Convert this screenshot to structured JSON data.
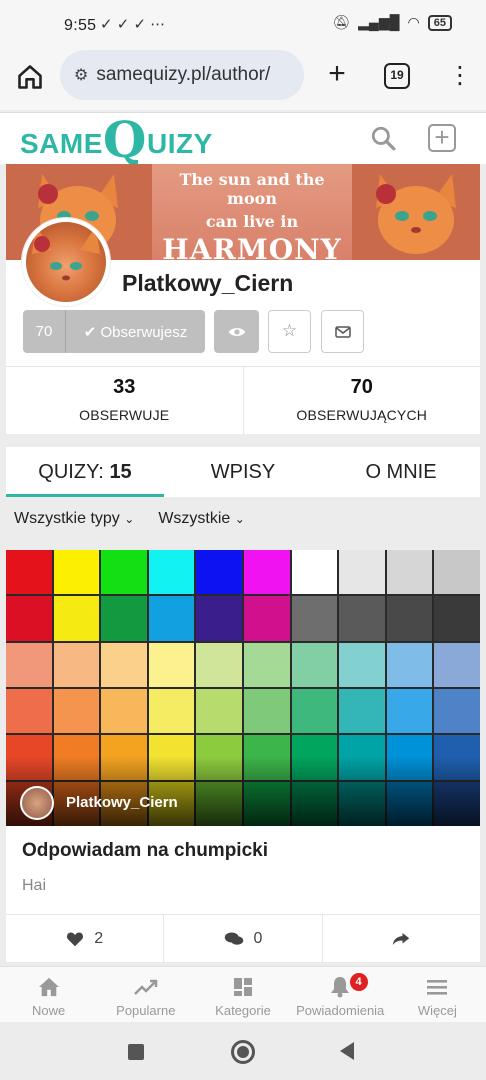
{
  "status_bar": {
    "time": "9:55",
    "status_icons": "✓ ✓ ✓ ⋯",
    "battery": "65"
  },
  "browser": {
    "url": "samequizy.pl/author/",
    "tab_count": "19"
  },
  "site": {
    "logo_prefix": "same",
    "logo_q": "Q",
    "logo_suffix": "uizy",
    "accent_color": "#2fb7a6"
  },
  "banner": {
    "line1": "The sun and the moon",
    "line2": "can live in",
    "line3": "HARMONY"
  },
  "profile": {
    "username": "Platkowy_Ciern",
    "follower_count_button": "70",
    "follow_label": "✔ Obserwujesz",
    "star_icon": "☆"
  },
  "stats": [
    {
      "value": "33",
      "label": "OBSERWUJE"
    },
    {
      "value": "70",
      "label": "OBSERWUJĄCYCH"
    }
  ],
  "tabs": {
    "quizzes_label": "QUIZY:",
    "quizzes_count": "15",
    "posts_label": "WPISY",
    "about_label": "O MNIE"
  },
  "filters": {
    "type": "Wszystkie typy",
    "scope": "Wszystkie"
  },
  "quiz": {
    "author": "Platkowy_Ciern",
    "title": "Odpowiadam na chumpicki",
    "description": "Hai",
    "likes": "2",
    "comments": "0",
    "palette_colors": [
      "#e4131b",
      "#fcef00",
      "#13e013",
      "#12f2f2",
      "#0d12f0",
      "#f012f0",
      "#ffffff",
      "#e6e6e6",
      "#d6d6d6",
      "#c8c8c8",
      "#db1025",
      "#f5ea12",
      "#139a40",
      "#11a0e0",
      "#3a1e8c",
      "#d0108c",
      "#6e6e6e",
      "#5a5a5a",
      "#494949",
      "#3a3a3a",
      "#f2987a",
      "#f7b883",
      "#fbd08a",
      "#fbf18e",
      "#cfe69a",
      "#a4d996",
      "#82cfa5",
      "#82d0d0",
      "#7fbde8",
      "#8aa8d8",
      "#ee6e4c",
      "#f5944e",
      "#f8b75a",
      "#f6ec63",
      "#b8db6d",
      "#7fc97a",
      "#3eb87d",
      "#35b6b6",
      "#38a8e8",
      "#4f83c8",
      "#e84727",
      "#f07d25",
      "#f4a321",
      "#f3e331",
      "#8ccb3e",
      "#3cb54a",
      "#00a65d",
      "#00a4a6",
      "#0092d8",
      "#1f5fae",
      "#c0391b",
      "#d8641a",
      "#dd8b16",
      "#d6c817",
      "#5fad2c",
      "#0c9640",
      "#00874c",
      "#00817f",
      "#006ea8",
      "#1b4585"
    ]
  },
  "bottom_nav": [
    {
      "label": "Nowe"
    },
    {
      "label": "Popularne"
    },
    {
      "label": "Kategorie"
    },
    {
      "label": "Powiadomienia",
      "badge": "4"
    },
    {
      "label": "Więcej"
    }
  ]
}
